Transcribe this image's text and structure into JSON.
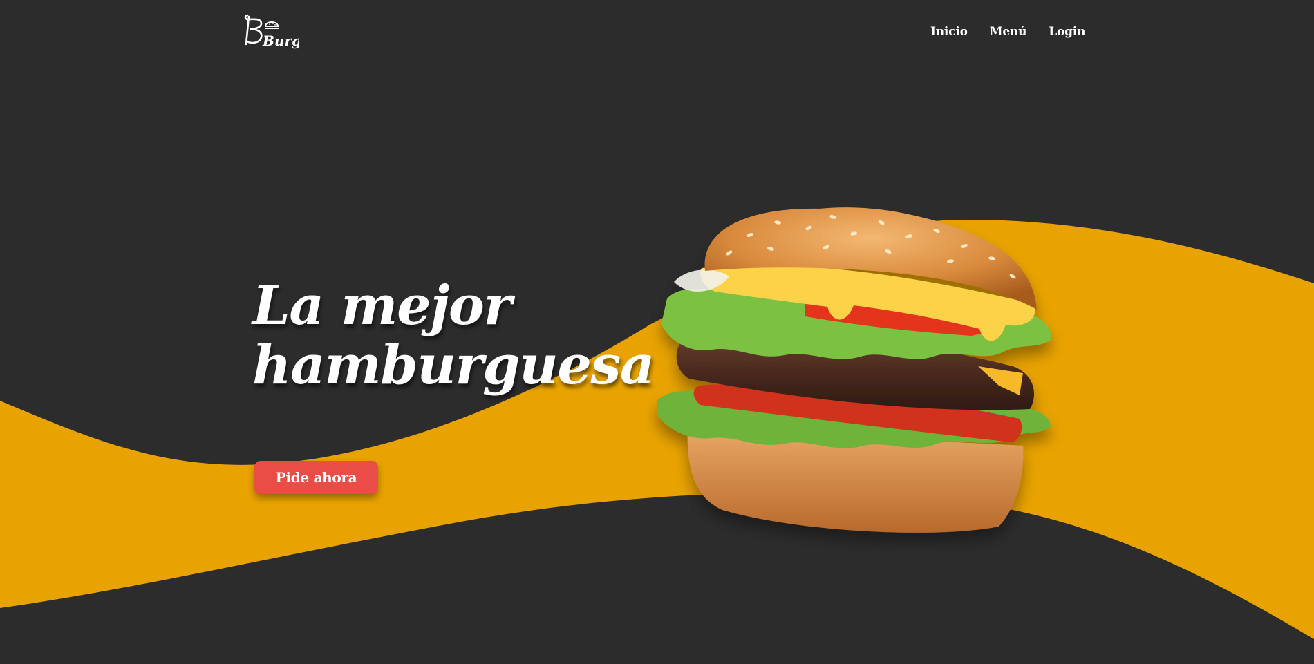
{
  "brand": {
    "logo_text": "Burger"
  },
  "nav": {
    "items": [
      {
        "label": "Inicio"
      },
      {
        "label": "Menú"
      },
      {
        "label": "Login"
      }
    ]
  },
  "hero": {
    "title_line1": "La mejor",
    "title_line2": "hamburguesa",
    "cta_label": "Pide ahora"
  },
  "colors": {
    "background": "#2d2c2d",
    "accent_wave": "#e8a300",
    "cta": "#ea4c46",
    "text": "#ffffff"
  },
  "icons": {
    "logo": "burger-logo",
    "hero_image": "hamburger-image"
  }
}
